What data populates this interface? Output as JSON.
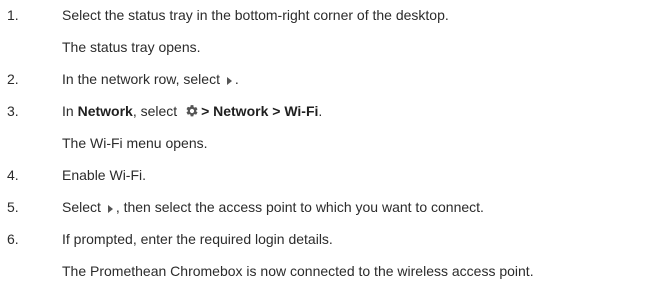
{
  "steps": [
    {
      "number": "1.",
      "text": "Select the status tray in the bottom-right corner of the desktop.",
      "result": "The status tray opens."
    },
    {
      "number": "2.",
      "pre": "In the network row, select ",
      "post": "."
    },
    {
      "number": "3.",
      "pre": "In ",
      "network_label": "Network",
      "mid": ", select ",
      "path": "> Network > Wi-Fi",
      "post": ".",
      "result": "The Wi-Fi menu opens."
    },
    {
      "number": "4.",
      "text": "Enable Wi-Fi."
    },
    {
      "number": "5.",
      "pre": "Select ",
      "post": ", then select the access point to which you want to connect."
    },
    {
      "number": "6.",
      "text": "If prompted, enter the required login details.",
      "result": "The Promethean Chromebox is now connected to the wireless access point."
    }
  ],
  "icons": {
    "expand": "expand-arrow-icon",
    "settings": "gear-icon"
  },
  "colors": {
    "text": "#2b2b2b",
    "icon": "#555555"
  }
}
